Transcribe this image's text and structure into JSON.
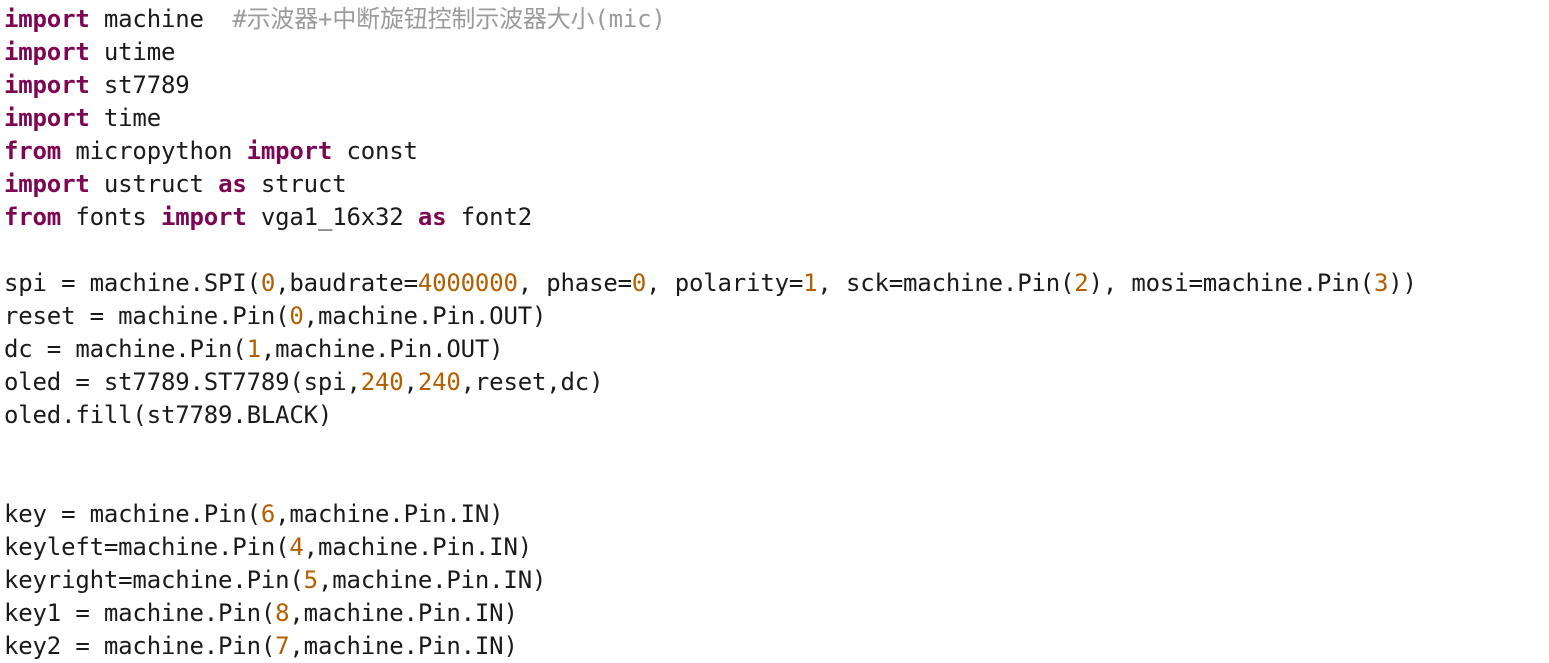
{
  "editor": {
    "language": "python",
    "background_color": "#ffffff",
    "keyword_color": "#7d0552",
    "number_color": "#b35f00",
    "comment_color": "#9b9b9b",
    "text_color": "#1a1a1a",
    "lines": [
      {
        "index": 1,
        "tokens": [
          {
            "t": "import",
            "k": "kw"
          },
          {
            "t": " machine  ",
            "k": "plain"
          },
          {
            "t": "#示波器+中断旋钮控制示波器大小(mic)",
            "k": "comment"
          }
        ]
      },
      {
        "index": 2,
        "tokens": [
          {
            "t": "import",
            "k": "kw"
          },
          {
            "t": " utime",
            "k": "plain"
          }
        ]
      },
      {
        "index": 3,
        "tokens": [
          {
            "t": "import",
            "k": "kw"
          },
          {
            "t": " st7789",
            "k": "plain"
          }
        ]
      },
      {
        "index": 4,
        "tokens": [
          {
            "t": "import",
            "k": "kw"
          },
          {
            "t": " time",
            "k": "plain"
          }
        ]
      },
      {
        "index": 5,
        "tokens": [
          {
            "t": "from",
            "k": "kw"
          },
          {
            "t": " micropython ",
            "k": "plain"
          },
          {
            "t": "import",
            "k": "kw"
          },
          {
            "t": " const",
            "k": "plain"
          }
        ]
      },
      {
        "index": 6,
        "tokens": [
          {
            "t": "import",
            "k": "kw"
          },
          {
            "t": " ustruct ",
            "k": "plain"
          },
          {
            "t": "as",
            "k": "kw"
          },
          {
            "t": " struct",
            "k": "plain"
          }
        ]
      },
      {
        "index": 7,
        "tokens": [
          {
            "t": "from",
            "k": "kw"
          },
          {
            "t": " fonts ",
            "k": "plain"
          },
          {
            "t": "import",
            "k": "kw"
          },
          {
            "t": " vga1_16x32 ",
            "k": "plain"
          },
          {
            "t": "as",
            "k": "kw"
          },
          {
            "t": " font2",
            "k": "plain"
          }
        ]
      },
      {
        "index": 8,
        "tokens": []
      },
      {
        "index": 9,
        "tokens": [
          {
            "t": "spi = machine.SPI(",
            "k": "plain"
          },
          {
            "t": "0",
            "k": "num"
          },
          {
            "t": ",baudrate=",
            "k": "plain"
          },
          {
            "t": "4000000",
            "k": "num"
          },
          {
            "t": ", phase=",
            "k": "plain"
          },
          {
            "t": "0",
            "k": "num"
          },
          {
            "t": ", polarity=",
            "k": "plain"
          },
          {
            "t": "1",
            "k": "num"
          },
          {
            "t": ", sck=machine.Pin(",
            "k": "plain"
          },
          {
            "t": "2",
            "k": "num"
          },
          {
            "t": "), mosi=machine.Pin(",
            "k": "plain"
          },
          {
            "t": "3",
            "k": "num"
          },
          {
            "t": "))",
            "k": "plain"
          }
        ]
      },
      {
        "index": 10,
        "tokens": [
          {
            "t": "reset = machine.Pin(",
            "k": "plain"
          },
          {
            "t": "0",
            "k": "num"
          },
          {
            "t": ",machine.Pin.OUT)",
            "k": "plain"
          }
        ]
      },
      {
        "index": 11,
        "tokens": [
          {
            "t": "dc = machine.Pin(",
            "k": "plain"
          },
          {
            "t": "1",
            "k": "num"
          },
          {
            "t": ",machine.Pin.OUT)",
            "k": "plain"
          }
        ]
      },
      {
        "index": 12,
        "tokens": [
          {
            "t": "oled = st7789.ST7789(spi,",
            "k": "plain"
          },
          {
            "t": "240",
            "k": "num"
          },
          {
            "t": ",",
            "k": "plain"
          },
          {
            "t": "240",
            "k": "num"
          },
          {
            "t": ",reset,dc)",
            "k": "plain"
          }
        ]
      },
      {
        "index": 13,
        "tokens": [
          {
            "t": "oled.fill(st7789.BLACK)",
            "k": "plain"
          }
        ]
      },
      {
        "index": 14,
        "tokens": []
      },
      {
        "index": 15,
        "tokens": []
      },
      {
        "index": 16,
        "tokens": [
          {
            "t": "key = machine.Pin(",
            "k": "plain"
          },
          {
            "t": "6",
            "k": "num"
          },
          {
            "t": ",machine.Pin.IN)",
            "k": "plain"
          }
        ]
      },
      {
        "index": 17,
        "tokens": [
          {
            "t": "keyleft=machine.Pin(",
            "k": "plain"
          },
          {
            "t": "4",
            "k": "num"
          },
          {
            "t": ",machine.Pin.IN)",
            "k": "plain"
          }
        ]
      },
      {
        "index": 18,
        "tokens": [
          {
            "t": "keyright=machine.Pin(",
            "k": "plain"
          },
          {
            "t": "5",
            "k": "num"
          },
          {
            "t": ",machine.Pin.IN)",
            "k": "plain"
          }
        ]
      },
      {
        "index": 19,
        "tokens": [
          {
            "t": "key1 = machine.Pin(",
            "k": "plain"
          },
          {
            "t": "8",
            "k": "num"
          },
          {
            "t": ",machine.Pin.IN)",
            "k": "plain"
          }
        ]
      },
      {
        "index": 20,
        "tokens": [
          {
            "t": "key2 = machine.Pin(",
            "k": "plain"
          },
          {
            "t": "7",
            "k": "num"
          },
          {
            "t": ",machine.Pin.IN)",
            "k": "plain"
          }
        ]
      }
    ]
  }
}
